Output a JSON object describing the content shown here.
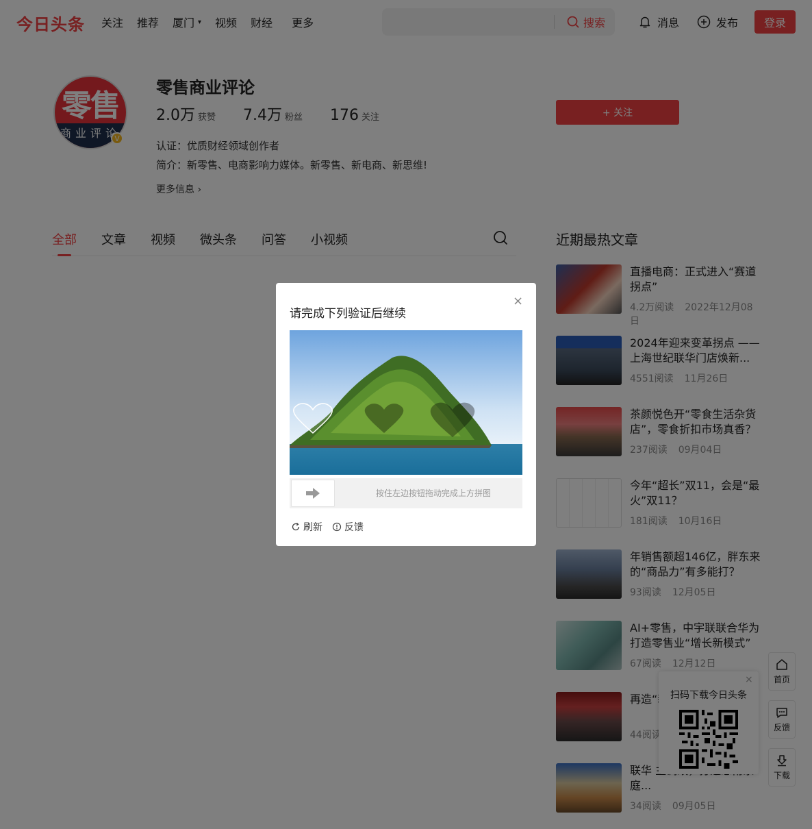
{
  "header": {
    "logo": "今日头条",
    "nav": [
      {
        "label": "关注"
      },
      {
        "label": "推荐"
      },
      {
        "label": "厦门"
      },
      {
        "label": "视频"
      },
      {
        "label": "财经"
      },
      {
        "label": "更多"
      }
    ],
    "search_placeholder": "",
    "search_button": "搜索",
    "messages": "消息",
    "publish": "发布",
    "login": "登录"
  },
  "profile": {
    "avatar_top": "零售",
    "avatar_bottom": "商业评论",
    "verified_mark": "V",
    "name": "零售商业评论",
    "stats": [
      {
        "num": "2.0万",
        "label": "获赞"
      },
      {
        "num": "7.4万",
        "label": "粉丝"
      },
      {
        "num": "176",
        "label": "关注"
      }
    ],
    "follow_button": "+ 关注",
    "certification": "认证：优质财经领域创作者",
    "intro": "简介：新零售、电商影响力媒体。新零售、新电商、新思维!",
    "more_info": "更多信息 ›"
  },
  "tabs": [
    {
      "label": "全部",
      "active": true
    },
    {
      "label": "文章"
    },
    {
      "label": "视频"
    },
    {
      "label": "微头条"
    },
    {
      "label": "问答"
    },
    {
      "label": "小视频"
    }
  ],
  "hot": {
    "title": "近期最热文章",
    "items": [
      {
        "headline": "直播电商：正式进入“赛道拐点”",
        "reads": "4.2万阅读",
        "date": "2022年12月08日"
      },
      {
        "headline": "2024年迎来变革拐点 —— 上海世纪联华门店焕新...",
        "reads": "4551阅读",
        "date": "11月26日"
      },
      {
        "headline": "茶颜悦色开“零食生活杂货店”，零食折扣市场真香？",
        "reads": "237阅读",
        "date": "09月04日"
      },
      {
        "headline": "今年“超长”双11，会是“最火”双11？",
        "reads": "181阅读",
        "date": "10月16日"
      },
      {
        "headline": "年销售额超146亿，胖东来的“商品力”有多能打？",
        "reads": "93阅读",
        "date": "12月05日"
      },
      {
        "headline": "AI+零售，中宇联联合华为打造零售业“增长新模式”",
        "reads": "67阅读",
        "date": "12月12日"
      },
      {
        "headline": "再造“新解",
        "reads": "44阅读",
        "date": ""
      },
      {
        "headline": "联华 主调改，打造恩甫家庭...",
        "reads": "34阅读",
        "date": "09月05日"
      }
    ]
  },
  "sidebar_tools": {
    "home": "首页",
    "feedback": "反馈",
    "download": "下载",
    "qr_title": "扫码下载今日头条",
    "qr_close": "×"
  },
  "captcha": {
    "title": "请完成下列验证后继续",
    "close": "×",
    "hint": "按住左边按钮拖动完成上方拼图",
    "refresh": "刷新",
    "feedback": "反馈"
  },
  "colors": {
    "brand": "#f04142",
    "overlay": "rgba(0,0,0,0.5)"
  }
}
